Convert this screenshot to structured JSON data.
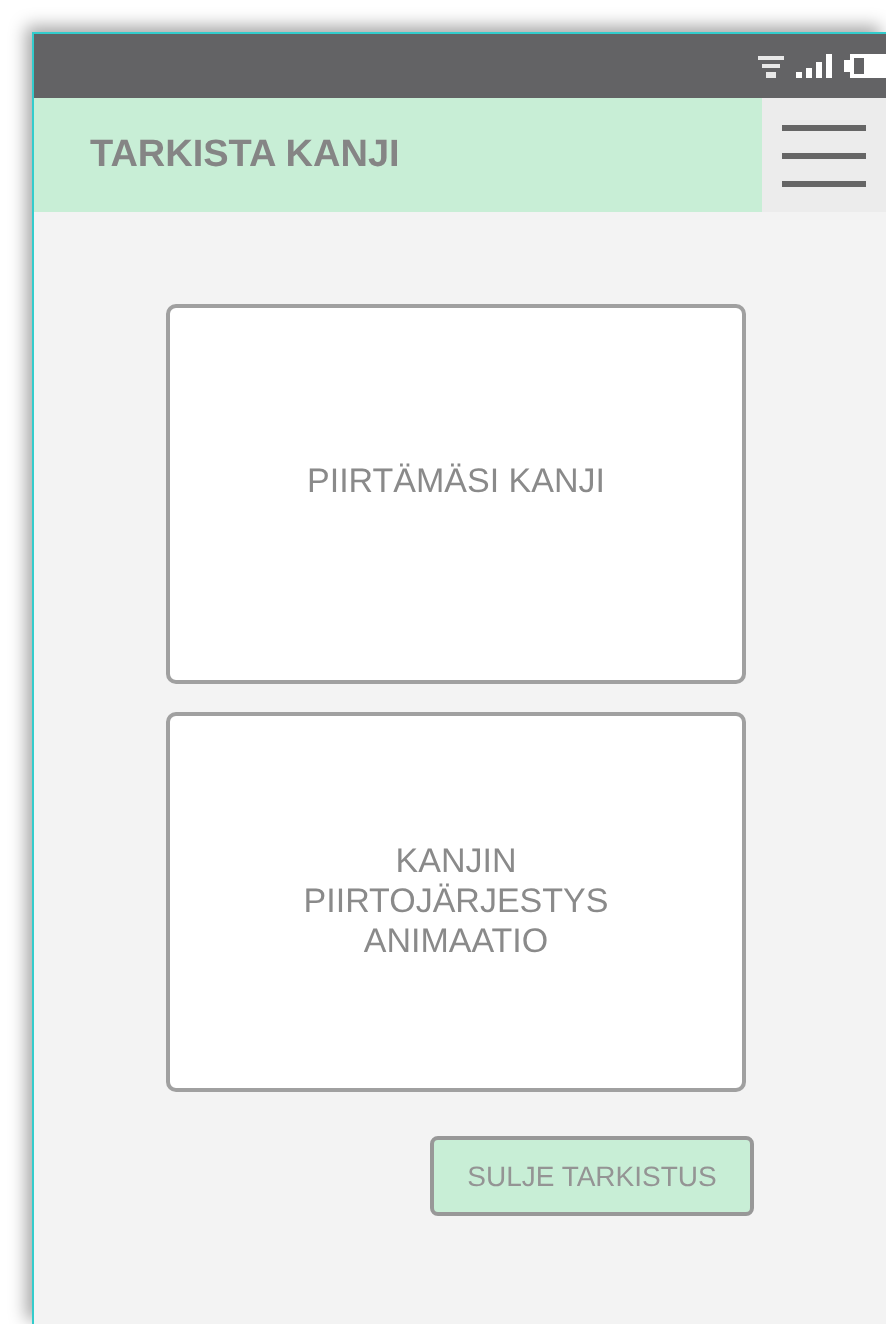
{
  "header": {
    "title": "TARKISTA KANJI"
  },
  "panels": [
    {
      "text": "PIIRTÄMÄSI KANJI"
    },
    {
      "text": "KANJIN PIIRTOJÄRJESTYS ANIMAATIO"
    }
  ],
  "close_button": {
    "label": "SULJE TARKISTUS"
  }
}
